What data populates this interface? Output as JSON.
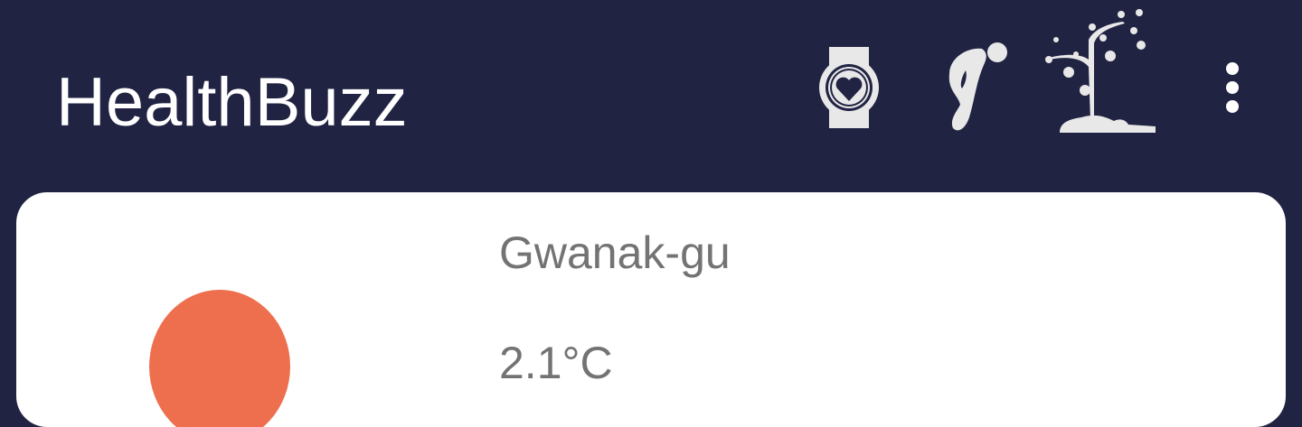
{
  "app": {
    "title": "HealthBuzz"
  },
  "toolbar": {
    "icons": [
      "smartwatch-heart-icon",
      "bowing-person-icon",
      "tree-growth-icon",
      "more-vert-icon"
    ]
  },
  "weather": {
    "location": "Gwanak-gu",
    "temperature": "2.1°C",
    "sun_color": "#ed6f4e"
  },
  "colors": {
    "appbar": "#212343",
    "icon": "#e8e8e8",
    "text_secondary": "#737373"
  }
}
